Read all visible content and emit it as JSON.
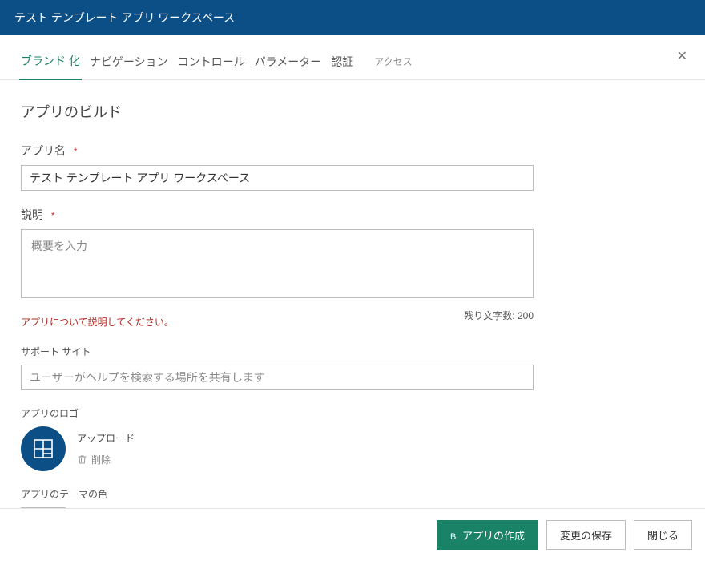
{
  "header": {
    "title": "テスト テンプレート アプリ ワークスペース"
  },
  "tabs": {
    "items": [
      {
        "label": "ブランド 化"
      },
      {
        "label": "ナビゲーション"
      },
      {
        "label": "コントロール"
      },
      {
        "label": "パラメーター"
      },
      {
        "label": "認証"
      }
    ],
    "extra": "アクセス"
  },
  "page": {
    "title": "アプリのビルド"
  },
  "app_name": {
    "label": "アプリ名",
    "value": "テスト テンプレート アプリ ワークスペース"
  },
  "description": {
    "label": "説明",
    "placeholder": "概要を入力",
    "error": "アプリについて説明してください。",
    "char_count_label": "残り文字数:",
    "char_count_value": "200"
  },
  "support_site": {
    "label": "サポート サイト",
    "placeholder": "ユーザーがヘルプを検索する場所を共有します"
  },
  "logo": {
    "label": "アプリのロゴ",
    "upload": "アップロード",
    "delete": "削除"
  },
  "theme_color": {
    "label": "アプリのテーマの色"
  },
  "footer": {
    "create_app": "アプリの作成",
    "save_changes": "変更の保存",
    "close": "閉じる"
  }
}
